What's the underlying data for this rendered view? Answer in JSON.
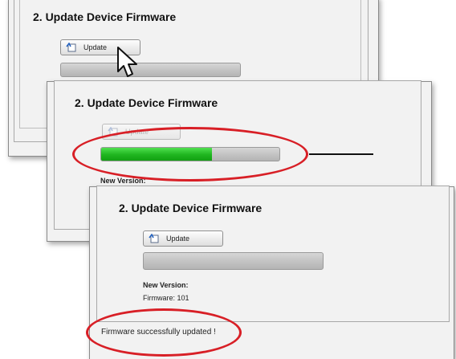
{
  "panels": [
    {
      "title": "2. Update Device Firmware",
      "update_button": "Update"
    },
    {
      "title": "2. Update Device Firmware",
      "update_button": "Update",
      "progress": 0.62,
      "new_version_label": "New Version:"
    },
    {
      "title": "2. Update Device Firmware",
      "update_button": "Update",
      "progress": 0,
      "new_version_label": "New Version:",
      "firmware_line": "Firmware:  101",
      "status_message": "Firmware successfully updated !"
    }
  ],
  "colors": {
    "progress_fill": "#1fb51f",
    "highlight_ring": "#d81f26"
  },
  "icons": [
    "update-icon",
    "mouse-pointer-icon"
  ]
}
